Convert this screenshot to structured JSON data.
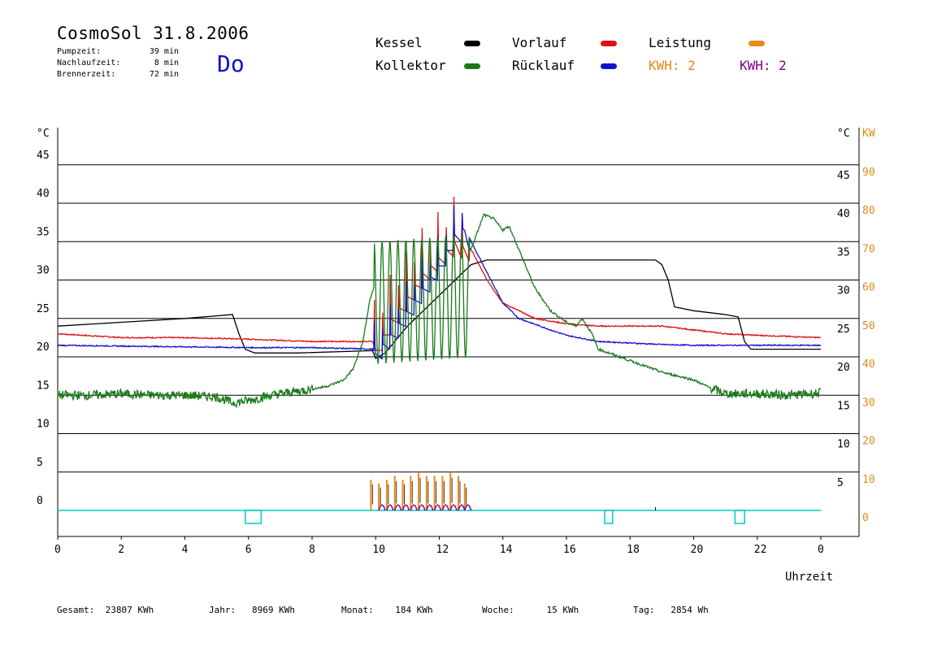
{
  "header": {
    "title": "CosmoSol 31.8.2006",
    "day": "Do",
    "stats": [
      {
        "label": "Pumpzeit:",
        "value": "39 min"
      },
      {
        "label": "Nachlaufzeit:",
        "value": "8 min"
      },
      {
        "label": "Brennerzeit:",
        "value": "72 min"
      }
    ]
  },
  "legend": {
    "kessel": {
      "label": "Kessel",
      "color": "#000000"
    },
    "kollektor": {
      "label": "Kollektor",
      "color": "#1a7a1a"
    },
    "vorlauf": {
      "label": "Vorlauf",
      "color": "#dd1111"
    },
    "ruecklauf": {
      "label": "Rücklauf",
      "color": "#1111cc"
    },
    "leistung": {
      "label": "Leistung",
      "color": "#ee8811"
    },
    "kwh_orange": {
      "label": "KWH: 2",
      "color": "#e08a1a"
    },
    "kwh_purple": {
      "label": "KWH: 2",
      "color": "#800080"
    }
  },
  "footer": {
    "totals": [
      {
        "label": "Gesamt:",
        "value": "23807 KWh"
      },
      {
        "label": "Jahr:",
        "value": "8969 KWh"
      },
      {
        "label": "Monat:",
        "value": "184 KWh"
      },
      {
        "label": "Woche:",
        "value": "15 KWh"
      },
      {
        "label": "Tag:",
        "value": "2854 Wh"
      }
    ]
  },
  "chart_data": {
    "type": "line",
    "xlabel": "Uhrzeit",
    "x_ticks": [
      "0",
      "2",
      "4",
      "6",
      "8",
      "10",
      "12",
      "14",
      "16",
      "18",
      "20",
      "22",
      "0"
    ],
    "xlim": [
      0,
      24
    ],
    "ylabel_left": "°C",
    "ylabel_right": "°C",
    "ylabel_right2": "KW",
    "ylim": [
      -2,
      50
    ],
    "y_ticks_left": [
      "0",
      "5",
      "10",
      "15",
      "20",
      "25",
      "30",
      "35",
      "40",
      "45"
    ],
    "y_ticks_right": [
      "5",
      "10",
      "15",
      "20",
      "25",
      "30",
      "35",
      "40",
      "45"
    ],
    "y_ticks_kw": [
      "0",
      "10",
      "20",
      "30",
      "40",
      "50",
      "60",
      "70",
      "80",
      "90"
    ],
    "grid": "horizontal",
    "series": [
      {
        "name": "Kessel",
        "color": "#000000",
        "points": [
          [
            0,
            24.0
          ],
          [
            2,
            24.5
          ],
          [
            4,
            25.0
          ],
          [
            5.5,
            25.5
          ],
          [
            5.7,
            23
          ],
          [
            5.9,
            21
          ],
          [
            6.2,
            20.5
          ],
          [
            7.5,
            20.5
          ],
          [
            9.9,
            20.8
          ],
          [
            10.0,
            19.8
          ],
          [
            10.3,
            20.5
          ],
          [
            10.6,
            22
          ],
          [
            11.0,
            24
          ],
          [
            11.5,
            26
          ],
          [
            12.0,
            28
          ],
          [
            12.5,
            30
          ],
          [
            13.0,
            32
          ],
          [
            13.5,
            32.6
          ],
          [
            16,
            32.6
          ],
          [
            18.8,
            32.6
          ],
          [
            19.0,
            32.0
          ],
          [
            19.2,
            30
          ],
          [
            19.4,
            26.5
          ],
          [
            20,
            26
          ],
          [
            21,
            25.5
          ],
          [
            21.4,
            25.2
          ],
          [
            21.6,
            22
          ],
          [
            21.8,
            21
          ],
          [
            24,
            21
          ]
        ]
      },
      {
        "name": "Vorlauf",
        "color": "#dd1111",
        "points": [
          [
            0,
            23.0
          ],
          [
            2,
            22.5
          ],
          [
            4,
            22.5
          ],
          [
            6,
            22.3
          ],
          [
            8,
            22.0
          ],
          [
            9.9,
            22.0
          ],
          [
            10.0,
            21
          ],
          [
            10.5,
            25
          ],
          [
            11,
            28
          ],
          [
            11.5,
            31
          ],
          [
            12,
            33
          ],
          [
            12.5,
            35
          ],
          [
            13,
            34
          ],
          [
            13.5,
            30
          ],
          [
            14,
            27
          ],
          [
            15,
            25
          ],
          [
            16,
            24.3
          ],
          [
            17,
            24
          ],
          [
            18,
            24
          ],
          [
            19,
            24
          ],
          [
            20,
            23.5
          ],
          [
            21,
            23
          ],
          [
            22,
            22.8
          ],
          [
            24,
            22.5
          ]
        ]
      },
      {
        "name": "Rücklauf",
        "color": "#1111cc",
        "points": [
          [
            0,
            21.5
          ],
          [
            2,
            21.4
          ],
          [
            4,
            21.3
          ],
          [
            6,
            21.2
          ],
          [
            8,
            21.2
          ],
          [
            9.9,
            21.0
          ],
          [
            10.0,
            20.5
          ],
          [
            10.5,
            23
          ],
          [
            11,
            26
          ],
          [
            11.5,
            29
          ],
          [
            12,
            32
          ],
          [
            12.5,
            36
          ],
          [
            12.8,
            37
          ],
          [
            13,
            35
          ],
          [
            13.5,
            31
          ],
          [
            14,
            27
          ],
          [
            14.5,
            25
          ],
          [
            15.5,
            23.5
          ],
          [
            16,
            22.8
          ],
          [
            17,
            22.0
          ],
          [
            18,
            21.8
          ],
          [
            19,
            21.6
          ],
          [
            20,
            21.5
          ],
          [
            22,
            21.5
          ],
          [
            24,
            21.5
          ]
        ]
      },
      {
        "name": "Kollektor",
        "color": "#1a7a1a",
        "points": [
          [
            0,
            15.0
          ],
          [
            1,
            15.0
          ],
          [
            2,
            15.2
          ],
          [
            3,
            15.0
          ],
          [
            4,
            15.0
          ],
          [
            5,
            14.8
          ],
          [
            5.5,
            14.0
          ],
          [
            6,
            14.3
          ],
          [
            6.5,
            14.8
          ],
          [
            7,
            15.2
          ],
          [
            8,
            15.8
          ],
          [
            8.5,
            16.2
          ],
          [
            9,
            17.0
          ],
          [
            9.3,
            18.5
          ],
          [
            9.6,
            22
          ],
          [
            9.8,
            27
          ],
          [
            10.0,
            30
          ],
          [
            13.0,
            34
          ],
          [
            13.4,
            38.5
          ],
          [
            13.7,
            38
          ],
          [
            14.0,
            36.5
          ],
          [
            14.2,
            37
          ],
          [
            14.5,
            34
          ],
          [
            15,
            29
          ],
          [
            15.5,
            26
          ],
          [
            16,
            24.5
          ],
          [
            16.3,
            24
          ],
          [
            16.5,
            25
          ],
          [
            16.8,
            23
          ],
          [
            17,
            21
          ],
          [
            18,
            19.5
          ],
          [
            19,
            18
          ],
          [
            20,
            17
          ],
          [
            20.5,
            16
          ],
          [
            21,
            15.2
          ],
          [
            22,
            15.2
          ],
          [
            23,
            15.0
          ],
          [
            24,
            15.3
          ]
        ]
      }
    ],
    "bars_leistung": {
      "color": "#ee8811",
      "x": [
        9.85,
        10.1,
        10.35,
        10.6,
        10.85,
        11.1,
        11.35,
        11.6,
        11.85,
        12.1,
        12.35,
        12.6,
        12.8
      ],
      "kw": [
        8,
        7,
        8,
        9,
        8,
        9,
        10,
        9,
        9,
        9,
        10,
        9,
        7
      ]
    },
    "power_purple": {
      "color": "#800080",
      "x": [
        10.1,
        10.35,
        10.6,
        10.85,
        11.1,
        11.35,
        11.6,
        11.85,
        12.1,
        12.35,
        12.6,
        12.8
      ],
      "kw": [
        2,
        2,
        2,
        2,
        2,
        2,
        2,
        2,
        2,
        2,
        2,
        2
      ]
    },
    "pump_markers": {
      "color": "#00c8c8",
      "intervals": [
        [
          5.9,
          6.4
        ],
        [
          17.2,
          17.45
        ],
        [
          21.3,
          21.6
        ]
      ]
    }
  }
}
